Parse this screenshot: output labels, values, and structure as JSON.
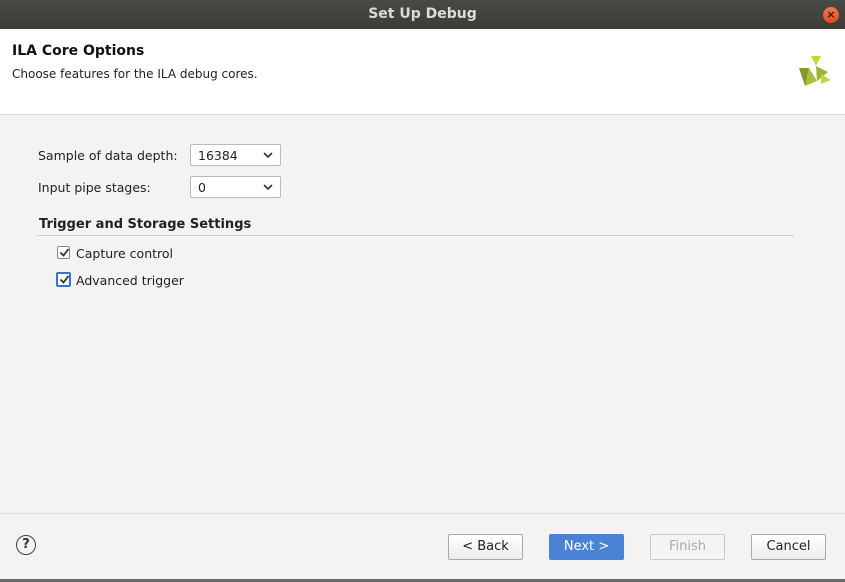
{
  "window": {
    "title": "Set Up Debug",
    "close_glyph": "×"
  },
  "header": {
    "title": "ILA Core Options",
    "subtitle": "Choose features for the ILA debug cores.",
    "logo": "xilinx-logo"
  },
  "options": {
    "sample_depth": {
      "label": "Sample of data depth:",
      "value": "16384"
    },
    "pipe_stages": {
      "label": "Input pipe stages:",
      "value": "0"
    }
  },
  "trigger": {
    "section_title": "Trigger and Storage Settings",
    "capture_control": {
      "label": "Capture control",
      "checked": true
    },
    "advanced_trigger": {
      "label": "Advanced trigger",
      "checked": true
    }
  },
  "footer": {
    "help_glyph": "?",
    "back_label": "< Back",
    "next_label": "Next >",
    "finish_label": "Finish",
    "cancel_label": "Cancel"
  },
  "colors": {
    "accent": "#4a83d4",
    "logo_green": "#8aa830"
  }
}
